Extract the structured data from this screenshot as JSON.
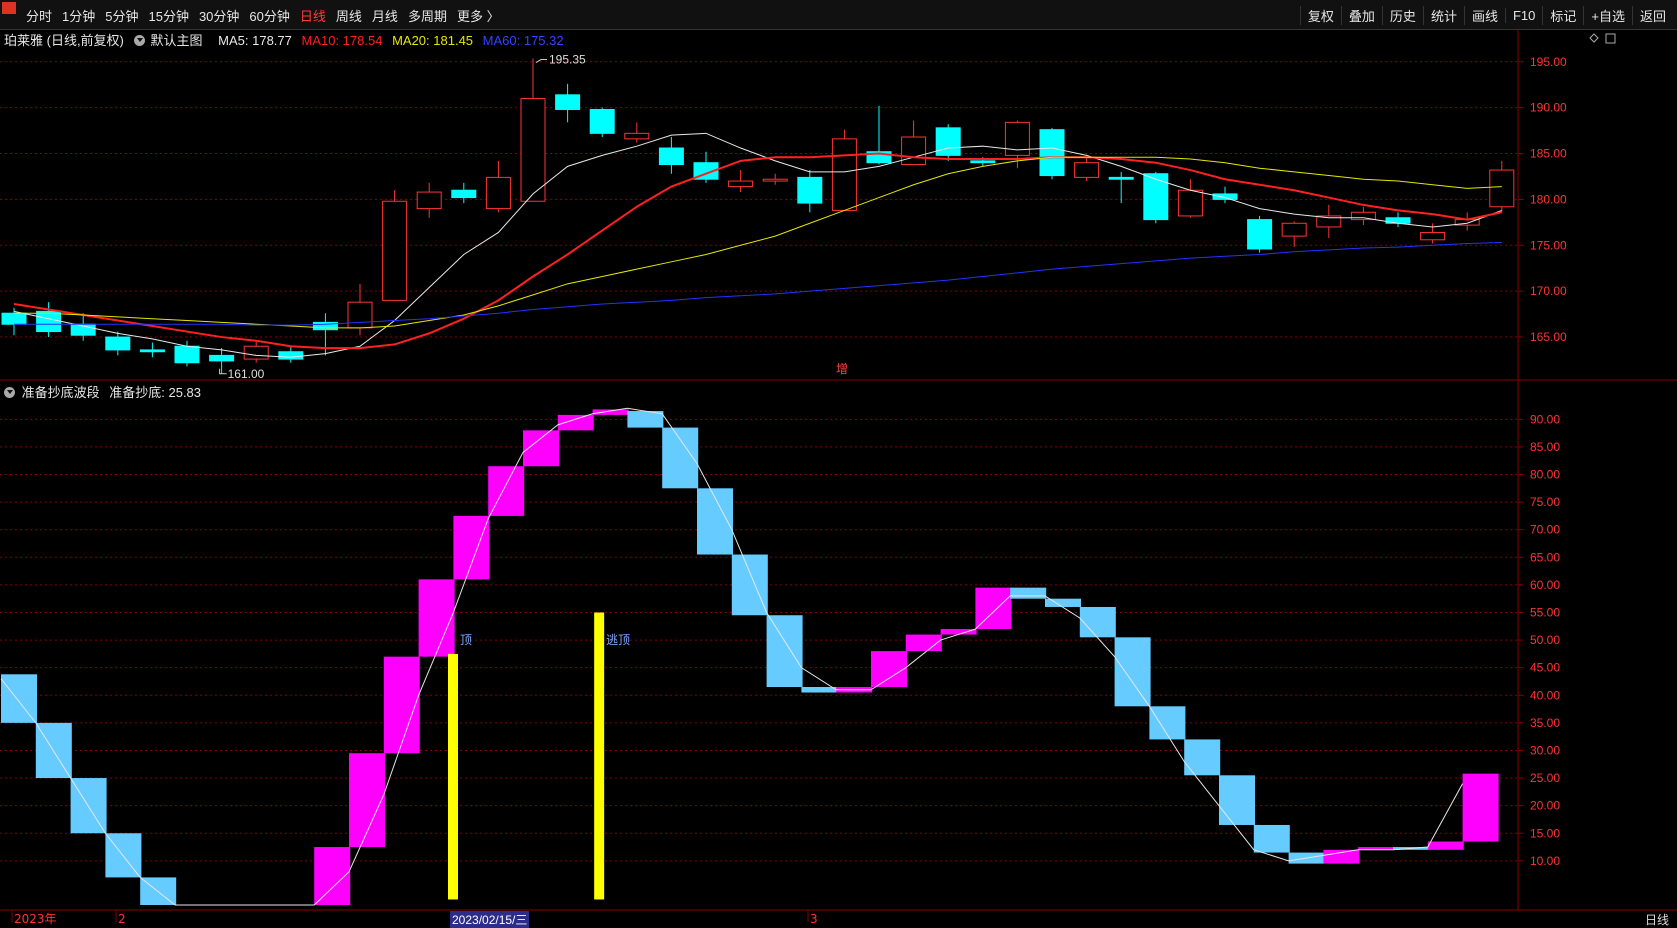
{
  "toolbar": {
    "tabs": [
      "分时",
      "1分钟",
      "5分钟",
      "15分钟",
      "30分钟",
      "60分钟",
      "日线",
      "周线",
      "月线",
      "多周期",
      "更多 〉"
    ],
    "active_tab": "日线",
    "right_buttons": [
      "复权",
      "叠加",
      "历史",
      "统计",
      "画线",
      "F10",
      "标记",
      "+自选",
      "返回"
    ]
  },
  "main_legend": {
    "stock": "珀莱雅 (日线,前复权)",
    "template": "默认主图",
    "ma5": "MA5: 178.77",
    "ma10": "MA10: 178.54",
    "ma20": "MA20: 181.45",
    "ma60": "MA60: 175.32"
  },
  "sub_legend": {
    "name": "准备抄底波段",
    "value": "准备抄底: 25.83"
  },
  "bottom": {
    "date_highlight": "2023/02/15/三",
    "period_label": "日线"
  },
  "colors": {
    "up": "#ff3333",
    "down": "#00ffff",
    "ma5": "#e8e8e8",
    "ma10": "#ff2020",
    "ma20": "#e6e600",
    "ma60": "#2233ff",
    "wave_up": "#ff00ff",
    "wave_down": "#66ccff",
    "signal": "#ffff00",
    "grid": "#8b0000",
    "axis_text": "#ff3333"
  },
  "chart_data": [
    {
      "type": "candlestick",
      "title": "珀莱雅 (日线,前复权)",
      "ylim": [
        162.5,
        196.5
      ],
      "y_ticks": [
        165.0,
        170.0,
        175.0,
        180.0,
        185.0,
        190.0,
        195.0
      ],
      "x_labels": [
        "2023年",
        "2",
        "3"
      ],
      "annotations": {
        "high": "195.35",
        "low": "161.00",
        "marker": "增"
      },
      "candles": [
        {
          "o": 167.6,
          "c": 166.4,
          "h": 168.2,
          "l": 165.2
        },
        {
          "o": 167.8,
          "c": 165.6,
          "h": 168.8,
          "l": 165.0
        },
        {
          "o": 166.4,
          "c": 165.2,
          "h": 167.6,
          "l": 164.6
        },
        {
          "o": 165.0,
          "c": 163.6,
          "h": 165.6,
          "l": 163.0
        },
        {
          "o": 163.6,
          "c": 163.4,
          "h": 164.4,
          "l": 162.8
        },
        {
          "o": 164.0,
          "c": 162.2,
          "h": 164.6,
          "l": 161.8
        },
        {
          "o": 163.0,
          "c": 162.4,
          "h": 163.8,
          "l": 161.0
        },
        {
          "o": 162.6,
          "c": 164.0,
          "h": 164.6,
          "l": 162.2
        },
        {
          "o": 163.4,
          "c": 162.6,
          "h": 164.0,
          "l": 162.2
        },
        {
          "o": 166.6,
          "c": 165.8,
          "h": 167.6,
          "l": 163.0
        },
        {
          "o": 166.0,
          "c": 168.8,
          "h": 170.8,
          "l": 165.2
        },
        {
          "o": 169.0,
          "c": 179.8,
          "h": 181.0,
          "l": 169.0
        },
        {
          "o": 179.0,
          "c": 180.8,
          "h": 181.8,
          "l": 178.0
        },
        {
          "o": 181.0,
          "c": 180.2,
          "h": 181.8,
          "l": 179.6
        },
        {
          "o": 179.0,
          "c": 182.4,
          "h": 184.2,
          "l": 178.6
        },
        {
          "o": 179.8,
          "c": 191.0,
          "h": 195.35,
          "l": 179.8
        },
        {
          "o": 191.4,
          "c": 189.8,
          "h": 192.6,
          "l": 188.4
        },
        {
          "o": 189.8,
          "c": 187.2,
          "h": 190.0,
          "l": 186.8
        },
        {
          "o": 186.6,
          "c": 187.2,
          "h": 188.4,
          "l": 186.2
        },
        {
          "o": 185.6,
          "c": 183.8,
          "h": 186.8,
          "l": 182.8
        },
        {
          "o": 184.0,
          "c": 182.2,
          "h": 185.2,
          "l": 181.8
        },
        {
          "o": 181.4,
          "c": 182.0,
          "h": 183.2,
          "l": 180.8
        },
        {
          "o": 182.0,
          "c": 182.2,
          "h": 182.8,
          "l": 181.6
        },
        {
          "o": 182.4,
          "c": 179.6,
          "h": 183.2,
          "l": 178.6
        },
        {
          "o": 178.8,
          "c": 186.6,
          "h": 187.6,
          "l": 178.8
        },
        {
          "o": 185.2,
          "c": 184.0,
          "h": 190.2,
          "l": 183.8
        },
        {
          "o": 183.8,
          "c": 186.8,
          "h": 188.6,
          "l": 183.8
        },
        {
          "o": 187.8,
          "c": 184.8,
          "h": 188.2,
          "l": 184.2
        },
        {
          "o": 184.2,
          "c": 184.0,
          "h": 184.6,
          "l": 183.6
        },
        {
          "o": 184.8,
          "c": 188.4,
          "h": 188.6,
          "l": 183.4
        },
        {
          "o": 187.6,
          "c": 182.6,
          "h": 187.8,
          "l": 182.2
        },
        {
          "o": 182.4,
          "c": 184.0,
          "h": 184.6,
          "l": 182.0
        },
        {
          "o": 182.4,
          "c": 182.2,
          "h": 183.0,
          "l": 179.6
        },
        {
          "o": 182.8,
          "c": 177.8,
          "h": 183.0,
          "l": 177.4
        },
        {
          "o": 178.2,
          "c": 181.0,
          "h": 182.2,
          "l": 178.0
        },
        {
          "o": 180.6,
          "c": 180.0,
          "h": 181.4,
          "l": 179.6
        },
        {
          "o": 177.8,
          "c": 174.6,
          "h": 178.2,
          "l": 174.2
        },
        {
          "o": 176.0,
          "c": 177.4,
          "h": 177.6,
          "l": 174.8
        },
        {
          "o": 177.0,
          "c": 178.2,
          "h": 179.4,
          "l": 175.8
        },
        {
          "o": 177.8,
          "c": 178.6,
          "h": 179.2,
          "l": 177.2
        },
        {
          "o": 178.0,
          "c": 177.4,
          "h": 178.6,
          "l": 177.0
        },
        {
          "o": 175.6,
          "c": 176.4,
          "h": 177.4,
          "l": 175.2
        },
        {
          "o": 177.2,
          "c": 177.8,
          "h": 178.6,
          "l": 176.6
        },
        {
          "o": 179.2,
          "c": 183.2,
          "h": 184.2,
          "l": 178.6
        }
      ],
      "series": [
        {
          "name": "MA5",
          "values": [
            167.8,
            167.0,
            166.2,
            165.4,
            164.8,
            164.0,
            163.6,
            163.0,
            162.8,
            163.2,
            164.0,
            166.8,
            170.4,
            174.0,
            176.4,
            180.6,
            183.6,
            184.8,
            185.8,
            187.0,
            187.2,
            185.6,
            184.2,
            183.0,
            183.0,
            183.6,
            184.6,
            185.6,
            185.8,
            185.4,
            185.6,
            184.8,
            183.6,
            182.2,
            181.0,
            180.2,
            179.0,
            178.4,
            178.0,
            178.0,
            177.4,
            177.0,
            177.4,
            178.8
          ]
        },
        {
          "name": "MA10",
          "values": [
            168.6,
            168.0,
            167.4,
            166.8,
            166.2,
            165.6,
            165.0,
            164.6,
            164.0,
            163.8,
            163.8,
            164.2,
            165.4,
            167.0,
            169.0,
            171.6,
            174.0,
            176.6,
            179.2,
            181.4,
            182.8,
            184.2,
            184.6,
            184.6,
            184.8,
            185.0,
            184.6,
            184.4,
            184.4,
            184.4,
            184.6,
            184.6,
            184.4,
            184.0,
            183.2,
            182.2,
            181.6,
            181.0,
            180.2,
            179.4,
            178.8,
            178.4,
            177.8,
            178.6
          ]
        },
        {
          "name": "MA20",
          "values": [
            167.6,
            167.6,
            167.4,
            167.2,
            167.0,
            166.8,
            166.6,
            166.4,
            166.2,
            166.0,
            166.0,
            166.2,
            166.8,
            167.4,
            168.4,
            169.6,
            170.8,
            171.6,
            172.4,
            173.2,
            174.0,
            175.0,
            176.0,
            177.4,
            178.8,
            180.2,
            181.6,
            182.8,
            183.6,
            184.2,
            184.6,
            184.6,
            184.6,
            184.6,
            184.4,
            184.0,
            183.4,
            183.0,
            182.6,
            182.2,
            182.0,
            181.6,
            181.2,
            181.4
          ]
        },
        {
          "name": "MA60",
          "values": [
            166.4,
            166.4,
            166.4,
            166.4,
            166.4,
            166.4,
            166.4,
            166.3,
            166.3,
            166.4,
            166.6,
            166.8,
            167.0,
            167.3,
            167.6,
            168.0,
            168.3,
            168.6,
            168.8,
            169.0,
            169.3,
            169.5,
            169.7,
            170.0,
            170.3,
            170.6,
            170.9,
            171.2,
            171.6,
            172.0,
            172.4,
            172.7,
            173.0,
            173.3,
            173.6,
            173.8,
            174.0,
            174.3,
            174.5,
            174.7,
            174.8,
            175.0,
            175.2,
            175.3
          ]
        }
      ]
    },
    {
      "type": "bar",
      "title": "准备抄底波段",
      "ylim": [
        2.0,
        93.5
      ],
      "y_ticks": [
        10.0,
        15.0,
        20.0,
        25.0,
        30.0,
        35.0,
        40.0,
        45.0,
        50.0,
        55.0,
        60.0,
        65.0,
        70.0,
        75.0,
        80.0,
        85.0,
        90.0
      ],
      "signal_labels": [
        "顶",
        "逃顶"
      ],
      "wave_line": [
        43.0,
        35.0,
        25.0,
        15.0,
        7.0,
        2.0,
        2.0,
        2.0,
        2.0,
        2.0,
        8.0,
        22.0,
        40.0,
        55.0,
        72.0,
        84.0,
        89.0,
        91.0,
        92.0,
        91.0,
        82.0,
        70.0,
        55.0,
        45.0,
        41.0,
        41.0,
        45.0,
        50.0,
        52.0,
        58.0,
        58.0,
        54.0,
        47.0,
        38.0,
        28.0,
        20.0,
        12.0,
        10.0,
        11.0,
        12.0,
        12.0,
        12.5,
        24.0
      ],
      "wave_boxes": [
        {
          "lo": 35.0,
          "hi": 43.8,
          "up": false
        },
        {
          "lo": 25.0,
          "hi": 35.0,
          "up": false
        },
        {
          "lo": 15.0,
          "hi": 25.0,
          "up": false
        },
        {
          "lo": 7.0,
          "hi": 15.0,
          "up": false
        },
        {
          "lo": 2.0,
          "hi": 7.0,
          "up": false
        },
        null,
        null,
        null,
        null,
        {
          "lo": 2.0,
          "hi": 12.5,
          "up": true
        },
        {
          "lo": 12.5,
          "hi": 29.5,
          "up": true
        },
        {
          "lo": 29.5,
          "hi": 47.0,
          "up": true
        },
        {
          "lo": 47.0,
          "hi": 61.0,
          "up": true
        },
        {
          "lo": 61.0,
          "hi": 72.5,
          "up": true
        },
        {
          "lo": 72.5,
          "hi": 81.5,
          "up": true
        },
        {
          "lo": 81.5,
          "hi": 88.0,
          "up": true
        },
        {
          "lo": 88.0,
          "hi": 90.8,
          "up": true
        },
        {
          "lo": 90.8,
          "hi": 91.8,
          "up": true
        },
        {
          "lo": 88.5,
          "hi": 91.5,
          "up": false
        },
        {
          "lo": 77.5,
          "hi": 88.5,
          "up": false
        },
        {
          "lo": 65.5,
          "hi": 77.5,
          "up": false
        },
        {
          "lo": 54.5,
          "hi": 65.5,
          "up": false
        },
        {
          "lo": 41.5,
          "hi": 54.5,
          "up": false
        },
        {
          "lo": 40.5,
          "hi": 41.5,
          "up": false
        },
        {
          "lo": 40.5,
          "hi": 41.5,
          "up": true
        },
        {
          "lo": 41.5,
          "hi": 48.0,
          "up": true
        },
        {
          "lo": 48.0,
          "hi": 51.0,
          "up": true
        },
        {
          "lo": 51.0,
          "hi": 52.0,
          "up": true
        },
        {
          "lo": 52.0,
          "hi": 59.5,
          "up": true
        },
        {
          "lo": 57.5,
          "hi": 59.5,
          "up": false
        },
        {
          "lo": 56.0,
          "hi": 57.5,
          "up": false
        },
        {
          "lo": 50.5,
          "hi": 56.0,
          "up": false
        },
        {
          "lo": 38.0,
          "hi": 50.5,
          "up": false
        },
        {
          "lo": 32.0,
          "hi": 38.0,
          "up": false
        },
        {
          "lo": 25.5,
          "hi": 32.0,
          "up": false
        },
        {
          "lo": 16.5,
          "hi": 25.5,
          "up": false
        },
        {
          "lo": 11.5,
          "hi": 16.5,
          "up": false
        },
        {
          "lo": 9.5,
          "hi": 11.5,
          "up": false
        },
        {
          "lo": 9.5,
          "hi": 12.0,
          "up": true
        },
        {
          "lo": 12.0,
          "hi": 12.5,
          "up": true
        },
        {
          "lo": 12.0,
          "hi": 12.5,
          "up": false
        },
        {
          "lo": 12.0,
          "hi": 13.5,
          "up": true
        },
        {
          "lo": 13.5,
          "hi": 25.8,
          "up": true
        }
      ],
      "signals": [
        {
          "index": 12.5,
          "lo": 3.0,
          "hi": 47.5,
          "label": "顶"
        },
        {
          "index": 16.7,
          "lo": 3.0,
          "hi": 55.0,
          "label": "逃顶"
        }
      ]
    }
  ]
}
